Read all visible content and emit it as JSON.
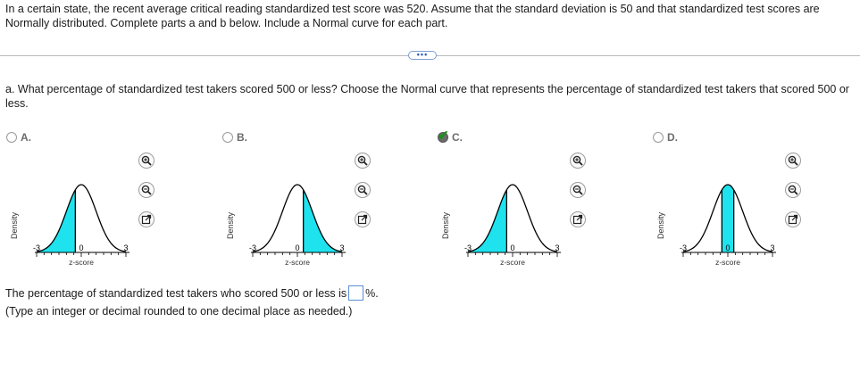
{
  "intro_text": "In a certain state, the recent average critical reading standardized test score was 520. Assume that the standard deviation is 50 and that standardized test scores are Normally distributed. Complete parts a and b below. Include a Normal curve for each part.",
  "more_button": "•••",
  "question_text": "a. What percentage of standardized test takers scored 500 or less? Choose the Normal curve that represents the percentage of standardized test takers that scored 500 or less.",
  "choices": [
    {
      "label": "A.",
      "selected": false,
      "shaded": "left of -0.4",
      "ylabel": "Density",
      "xlabel": "z-score",
      "ticks": [
        "-3",
        "0",
        "3"
      ]
    },
    {
      "label": "B.",
      "selected": false,
      "shaded": "right of 0.4",
      "ylabel": "Density",
      "xlabel": "z-score",
      "ticks": [
        "-3",
        "0",
        "3"
      ]
    },
    {
      "label": "C.",
      "selected": true,
      "shaded": "left of -0.4",
      "ylabel": "Density",
      "xlabel": "z-score",
      "ticks": [
        "-3",
        "0",
        "3"
      ]
    },
    {
      "label": "D.",
      "selected": false,
      "shaded": "between -0.4 and 0.4",
      "ylabel": "Density",
      "xlabel": "z-score",
      "ticks": [
        "-3",
        "0",
        "3"
      ]
    }
  ],
  "chart_data": [
    {
      "type": "area",
      "xlabel": "z-score",
      "ylabel": "Density",
      "xlim": [
        -3,
        3
      ],
      "x_ticks": [
        -3,
        0,
        3
      ],
      "shade_from": -3,
      "shade_to": -0.4,
      "cutoffs": [
        -0.4
      ],
      "fill_color": "#1ee3ee"
    },
    {
      "type": "area",
      "xlabel": "z-score",
      "ylabel": "Density",
      "xlim": [
        -3,
        3
      ],
      "x_ticks": [
        -3,
        0,
        3
      ],
      "shade_from": 0.4,
      "shade_to": 3,
      "cutoffs": [
        0.4
      ],
      "fill_color": "#1ee3ee"
    },
    {
      "type": "area",
      "xlabel": "z-score",
      "ylabel": "Density",
      "xlim": [
        -3,
        3
      ],
      "x_ticks": [
        -3,
        0,
        3
      ],
      "shade_from": -3,
      "shade_to": -0.4,
      "cutoffs": [
        -0.4
      ],
      "fill_color": "#1ee3ee"
    },
    {
      "type": "area",
      "xlabel": "z-score",
      "ylabel": "Density",
      "xlim": [
        -3,
        3
      ],
      "x_ticks": [
        -3,
        0,
        3
      ],
      "shade_from": -0.4,
      "shade_to": 0.4,
      "cutoffs": [
        -0.4,
        0.4
      ],
      "fill_color": "#1ee3ee"
    }
  ],
  "icons": [
    "zoom-in-icon",
    "zoom-out-icon",
    "open-external-icon"
  ],
  "answer": {
    "prefix": "The percentage of standardized test takers who scored 500 or less is",
    "value": "",
    "suffix": "%."
  },
  "hint": "(Type an integer or decimal rounded to one decimal place as needed.)"
}
